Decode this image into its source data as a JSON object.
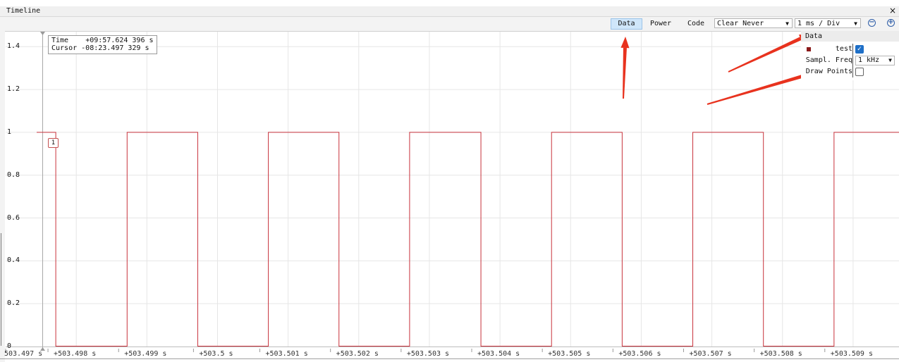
{
  "window": {
    "title": "Timeline",
    "close_glyph": "×"
  },
  "toolbar": {
    "data_label": "Data",
    "power_label": "Power",
    "code_label": "Code",
    "clear_mode": "Clear Never",
    "time_scale": "1 ms / Div",
    "zoom_out_icon": "zoom-out-icon",
    "zoom_in_icon": "zoom-in-icon"
  },
  "readout": {
    "time_label": "Time",
    "time_value": "+09:57.624 396 s",
    "cursor_label": "Cursor",
    "cursor_value": "-08:23.497 329 s"
  },
  "channel_marker": "1",
  "data_panel": {
    "header": "Data",
    "channel_name": "test",
    "channel_enabled": true,
    "channel_color": "#8b1a1a",
    "sampl_freq_label": "Sampl. Freq",
    "sampl_freq_value": "1 kHz",
    "draw_points_label": "Draw Points",
    "draw_points": false
  },
  "chart_data": {
    "type": "line",
    "step": true,
    "series": [
      {
        "name": "test",
        "color": "#c8323c"
      }
    ],
    "y_ticks": [
      "0",
      "0.2",
      "0.4",
      "0.6",
      "0.8",
      "1",
      "1.2",
      "1.4"
    ],
    "x_ticks": [
      "503.497 s",
      "+503.498 s",
      "+503.499 s",
      "+503.5 s",
      "+503.501 s",
      "+503.502 s",
      "+503.503 s",
      "+503.504 s",
      "+503.505 s",
      "+503.506 s",
      "+503.507 s",
      "+503.508 s",
      "+503.509 s"
    ],
    "x_tick_values": [
      503.497,
      503.498,
      503.499,
      503.5,
      503.501,
      503.502,
      503.503,
      503.504,
      503.505,
      503.506,
      503.507,
      503.508,
      503.509
    ],
    "xlim": [
      503.497,
      503.50965
    ],
    "ylim": [
      0,
      1.47
    ],
    "high_intervals": [
      [
        503.497,
        503.49771
      ],
      [
        503.49872,
        503.49972
      ],
      [
        503.50072,
        503.50172
      ],
      [
        503.50272,
        503.50373
      ],
      [
        503.50473,
        503.50573
      ],
      [
        503.50673,
        503.50773
      ],
      [
        503.50873,
        503.50965
      ]
    ],
    "grid": true
  },
  "colors": {
    "accent": "#cfe6fa",
    "signal": "#c8323c",
    "checkbox": "#1e6fc7",
    "arrow": "#e8321e"
  }
}
